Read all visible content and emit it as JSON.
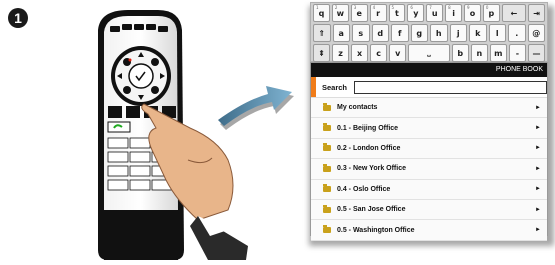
{
  "step": {
    "number": "1"
  },
  "keyboard": {
    "rows": [
      [
        {
          "k": "q",
          "s": "1"
        },
        {
          "k": "w",
          "s": "2"
        },
        {
          "k": "e",
          "s": "3"
        },
        {
          "k": "r",
          "s": "4"
        },
        {
          "k": "t",
          "s": "5"
        },
        {
          "k": "y",
          "s": "6"
        },
        {
          "k": "u",
          "s": "7"
        },
        {
          "k": "i",
          "s": "8"
        },
        {
          "k": "o",
          "s": "9"
        },
        {
          "k": "p",
          "s": "0"
        },
        {
          "k": "←",
          "s": ""
        },
        {
          "k": "⇥",
          "s": ""
        }
      ],
      [
        {
          "k": "⇑",
          "s": ""
        },
        {
          "k": "a",
          "s": ""
        },
        {
          "k": "s",
          "s": ""
        },
        {
          "k": "d",
          "s": ""
        },
        {
          "k": "f",
          "s": ""
        },
        {
          "k": "g",
          "s": ""
        },
        {
          "k": "h",
          "s": ""
        },
        {
          "k": "j",
          "s": ""
        },
        {
          "k": "k",
          "s": ""
        },
        {
          "k": "l",
          "s": ""
        },
        {
          "k": ".",
          "s": ""
        },
        {
          "k": "@",
          "s": ""
        }
      ],
      [
        {
          "k": "⇞",
          "s": ""
        },
        {
          "k": "z",
          "s": ""
        },
        {
          "k": "x",
          "s": ""
        },
        {
          "k": "c",
          "s": ""
        },
        {
          "k": "v",
          "s": ""
        },
        {
          "k": "⎵",
          "s": ""
        },
        {
          "k": "b",
          "s": ""
        },
        {
          "k": "n",
          "s": ""
        },
        {
          "k": "m",
          "s": ""
        },
        {
          "k": "-",
          "s": ""
        },
        {
          "k": "—",
          "s": ""
        }
      ]
    ]
  },
  "phonebook": {
    "title": "PHONE BOOK",
    "search_label": "Search",
    "search_value": "",
    "items": [
      {
        "label": "My contacts"
      },
      {
        "label": "0.1 - Beijing Office"
      },
      {
        "label": "0.2 - London Office"
      },
      {
        "label": "0.3 - New York Office"
      },
      {
        "label": "0.4 - Oslo Office"
      },
      {
        "label": "0.5 - San Jose Office"
      },
      {
        "label": "0.5 - Washington Office"
      }
    ],
    "item_arrow": "►"
  },
  "colors": {
    "accent": "#f07c1a",
    "folder": "#c9a11b"
  }
}
